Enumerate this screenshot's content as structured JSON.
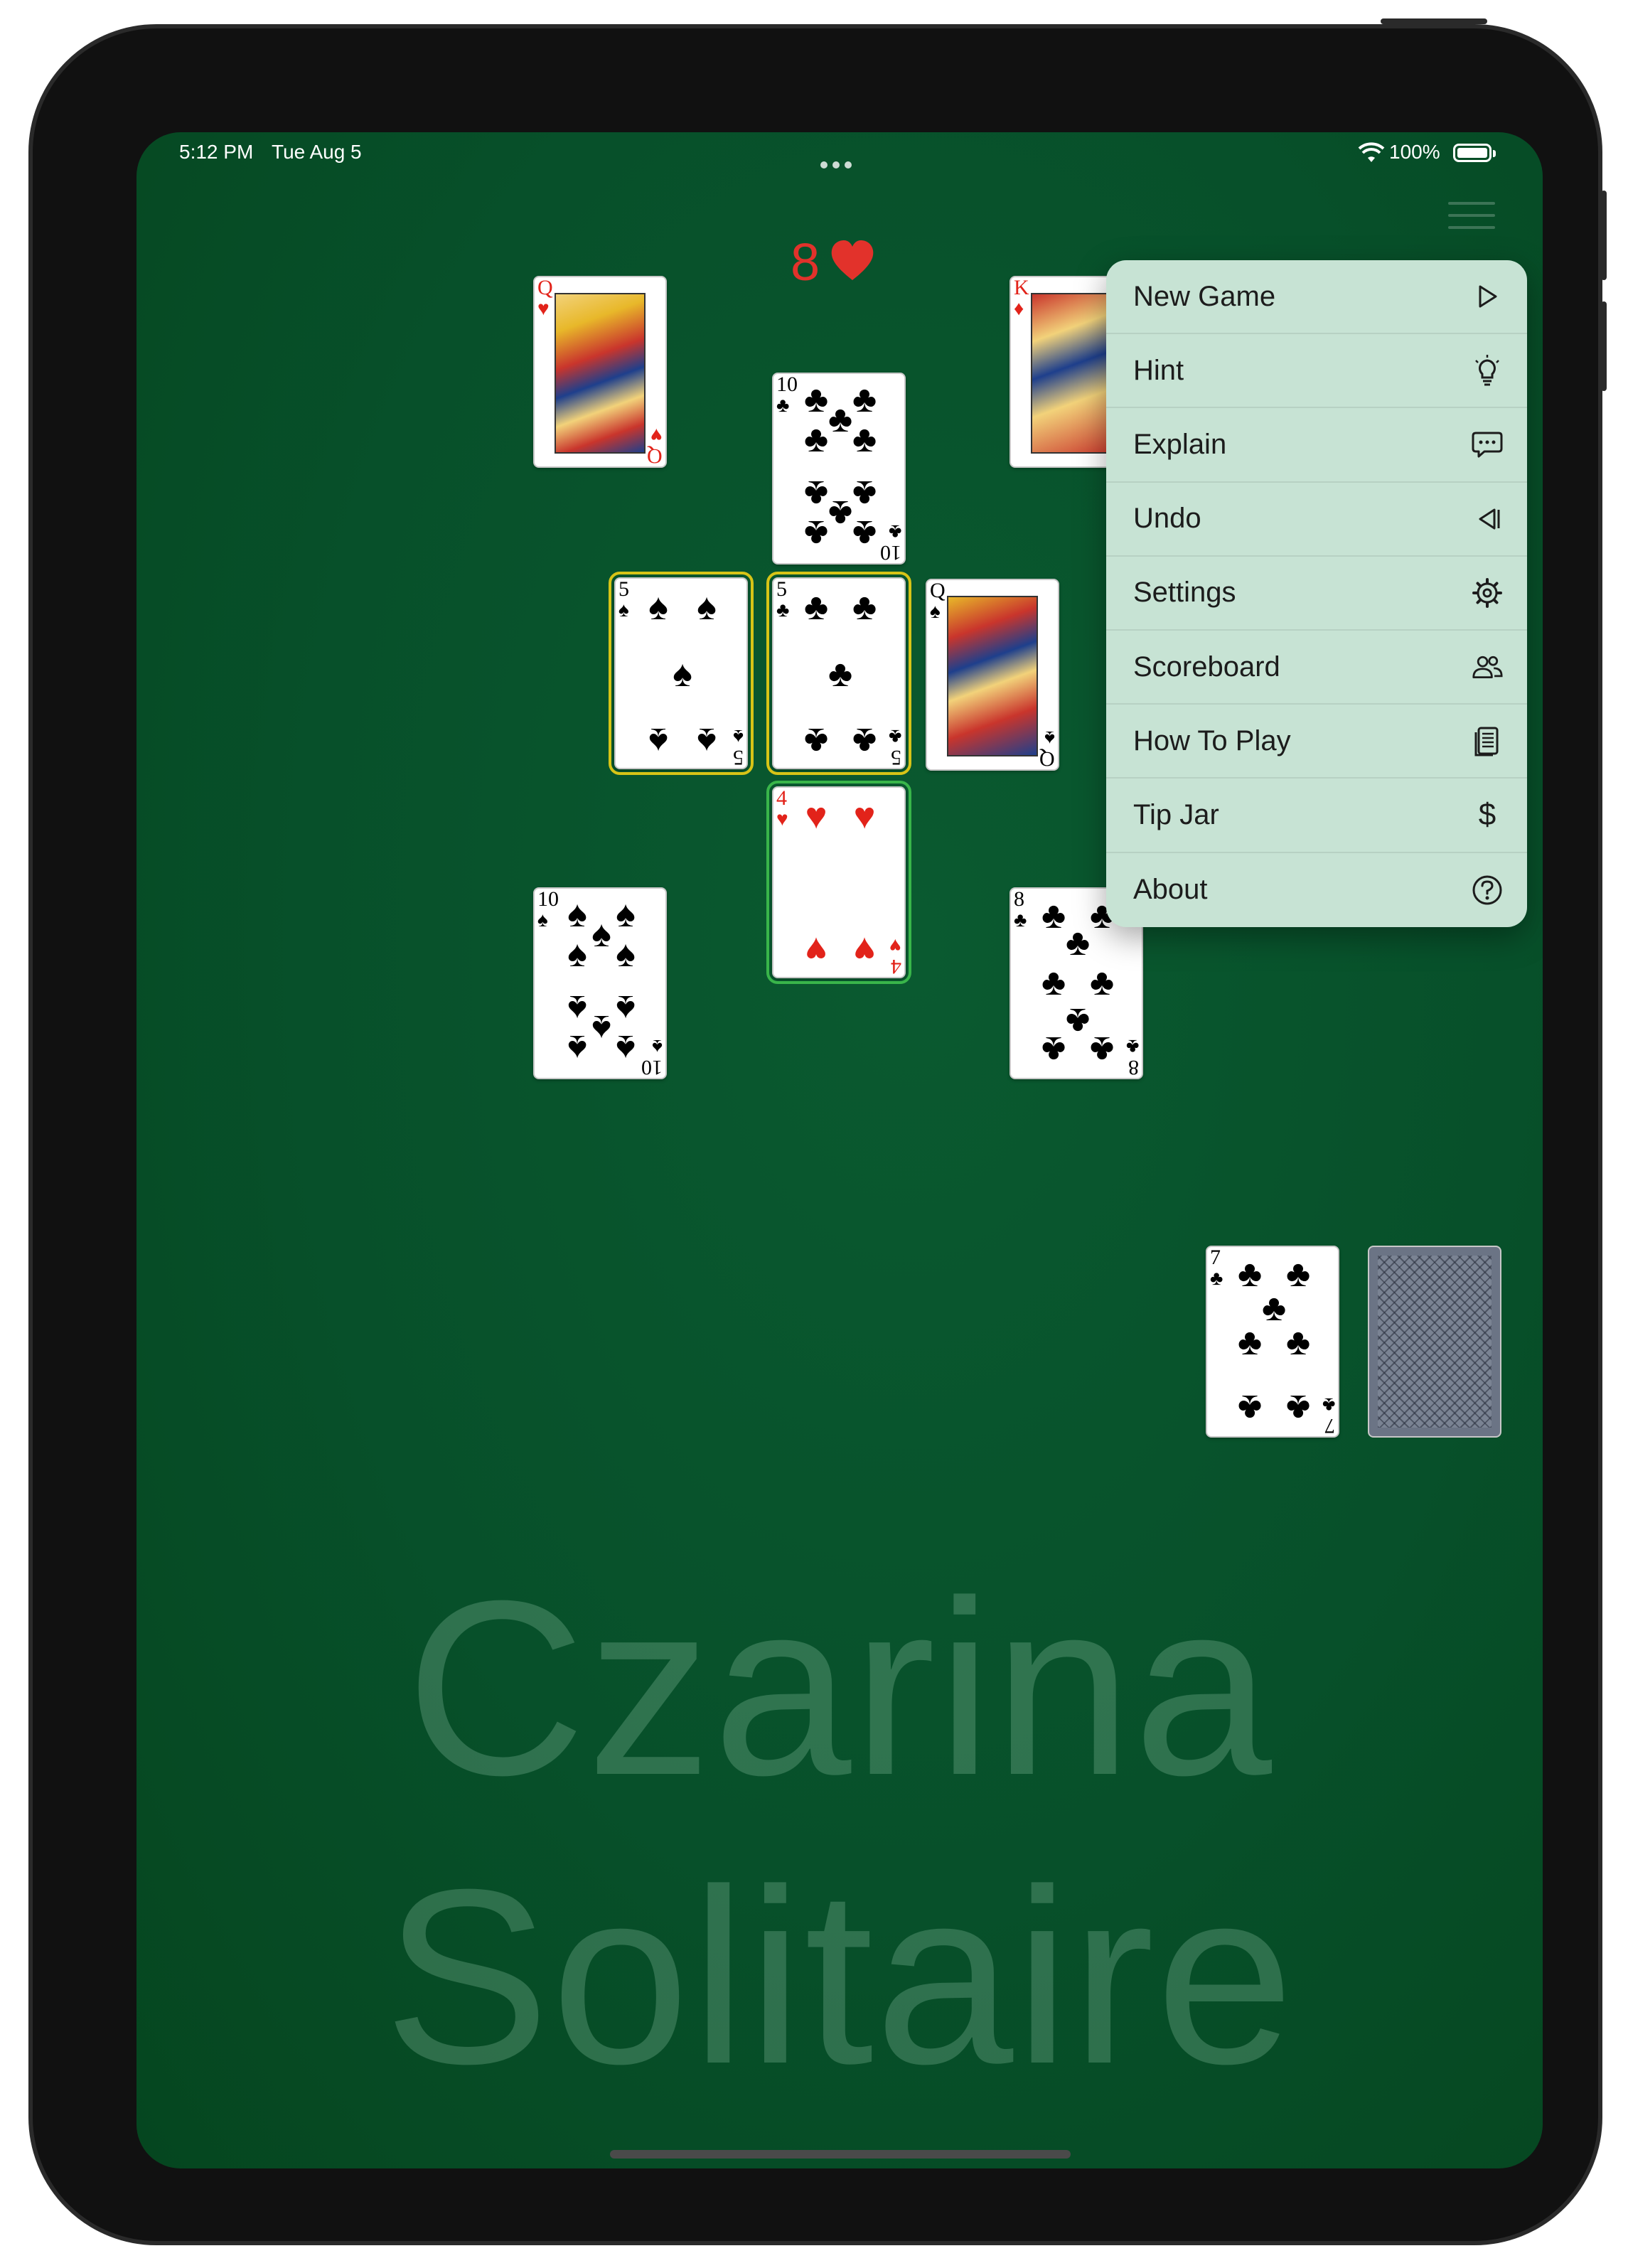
{
  "status_bar": {
    "time": "5:12 PM",
    "date": "Tue Aug 5",
    "battery": "100%"
  },
  "trump": {
    "value": "8",
    "suit": "heart",
    "color": "#e2322b"
  },
  "tableau": [
    {
      "id": "queen-of-hearts",
      "rank": "Q",
      "suit": "♥",
      "color": "red",
      "face": true
    },
    {
      "id": "king-of-diamonds",
      "rank": "K",
      "suit": "♦",
      "color": "red",
      "face": true
    },
    {
      "id": "ten-of-clubs",
      "rank": "10",
      "suit": "♣",
      "color": "black"
    },
    {
      "id": "five-of-spades",
      "rank": "5",
      "suit": "♠",
      "color": "black",
      "highlight": "yellow"
    },
    {
      "id": "five-of-clubs",
      "rank": "5",
      "suit": "♣",
      "color": "black",
      "highlight": "yellow"
    },
    {
      "id": "queen-of-spades",
      "rank": "Q",
      "suit": "♠",
      "color": "black",
      "face": true
    },
    {
      "id": "four-of-hearts",
      "rank": "4",
      "suit": "♥",
      "color": "red",
      "highlight": "green"
    },
    {
      "id": "ten-of-spades",
      "rank": "10",
      "suit": "♠",
      "color": "black"
    },
    {
      "id": "eight-of-clubs",
      "rank": "8",
      "suit": "♣",
      "color": "black"
    }
  ],
  "waste": {
    "rank": "7",
    "suit": "♣",
    "color": "black"
  },
  "menu": {
    "items": [
      {
        "label": "New Game",
        "icon": "play-icon"
      },
      {
        "label": "Hint",
        "icon": "lightbulb-icon"
      },
      {
        "label": "Explain",
        "icon": "speech-bubble-icon"
      },
      {
        "label": "Undo",
        "icon": "undo-icon"
      },
      {
        "label": "Settings",
        "icon": "gear-icon"
      },
      {
        "label": "Scoreboard",
        "icon": "people-icon"
      },
      {
        "label": "How To Play",
        "icon": "document-icon"
      },
      {
        "label": "Tip Jar",
        "icon": "dollar-icon"
      },
      {
        "label": "About",
        "icon": "question-icon"
      }
    ]
  },
  "watermark": {
    "line1": "Czarina",
    "line2": "Solitaire"
  },
  "colors": {
    "felt": "#07502a",
    "menu_bg": "#c7e3d4",
    "highlight_yellow": "#d7c417",
    "highlight_green": "#39b54a"
  }
}
